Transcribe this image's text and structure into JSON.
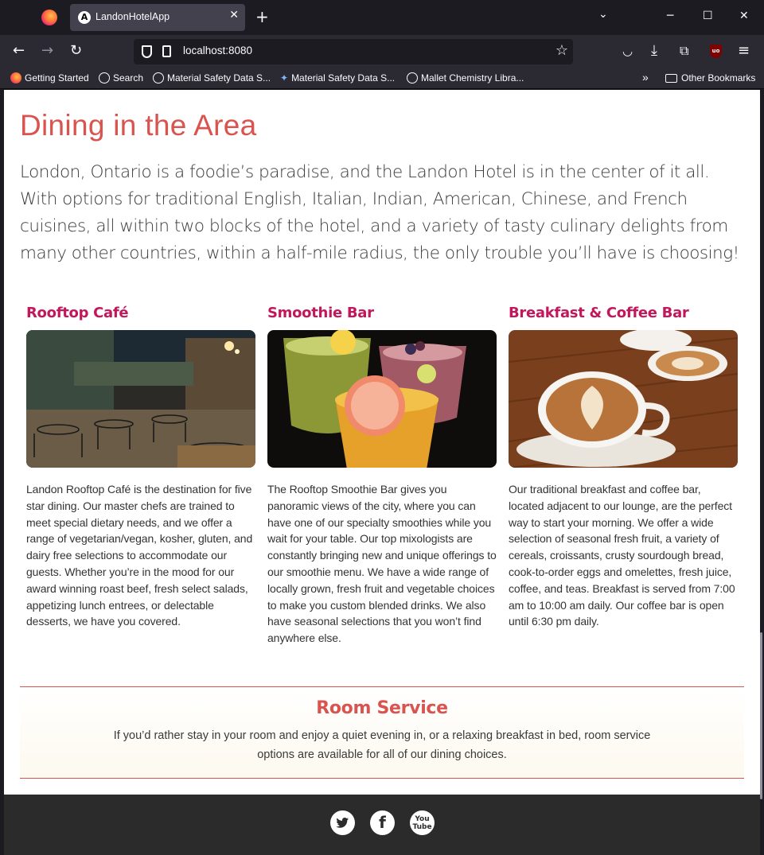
{
  "browser": {
    "tab_title": "LandonHotelApp",
    "tab_favicon_letter": "A",
    "url": "localhost:8080",
    "bookmarks": [
      {
        "label": "Getting Started",
        "icon": "firefox-icon"
      },
      {
        "label": "Search",
        "icon": "globe-icon"
      },
      {
        "label": "Material Safety Data S...",
        "icon": "globe-icon"
      },
      {
        "label": "Material Safety Data S...",
        "icon": "sparkle-icon"
      },
      {
        "label": "Mallet Chemistry Libra...",
        "icon": "globe-icon"
      }
    ],
    "other_bookmarks": "Other Bookmarks",
    "ublock_label": "uo"
  },
  "dining": {
    "title": "Dining in the Area",
    "intro": "London, Ontario is a foodie’s paradise, and the Landon Hotel is in the center of it all. With options for traditional English, Italian, Indian, American, Chinese, and French cuisines, all within two blocks of the hotel, and a variety of tasty culinary delights from many other countries, within a half-mile radius, the only trouble you’ll have is choosing!",
    "venues": [
      {
        "name": "Rooftop Café",
        "description": "Landon Rooftop Café is the destination for five star dining. Our master chefs are trained to meet special dietary needs, and we offer a range of vegetarian/vegan, kosher, gluten, and dairy free selections to accommodate our guests. Whether you’re in the mood for our award winning roast beef, fresh select salads, appetizing lunch entrees, or delectable desserts, we have you covered."
      },
      {
        "name": "Smoothie Bar",
        "description": "The Rooftop Smoothie Bar gives you panoramic views of the city, where you can have one of our specialty smoothies while you wait for your table. Our top mixologists are constantly bringing new and unique offerings to our smoothie menu. We have a wide range of locally grown, fresh fruit and vegetable choices to make you custom blended drinks. We also have seasonal selections that you won’t find anywhere else."
      },
      {
        "name": "Breakfast & Coffee Bar",
        "description": "Our traditional breakfast and coffee bar, located adjacent to our lounge, are the perfect way to start your morning. We offer a wide selection of seasonal fresh fruit, a variety of cereals, croissants, crusty sourdough bread, cook-to-order eggs and omelettes, fresh juice, coffee, and teas. Breakfast is served from 7:00 am to 10:00 am daily. Our coffee bar is open until 6:30 pm daily."
      }
    ]
  },
  "room_service": {
    "title": "Room Service",
    "text": "If you’d rather stay in your room and enjoy a quiet evening in, or a relaxing breakfast in bed, room service options are available for all of our dining choices."
  },
  "footer": {
    "social": [
      {
        "icon": "twitter-icon"
      },
      {
        "icon": "facebook-icon"
      },
      {
        "icon": "youtube-icon",
        "text": "You Tube"
      }
    ]
  },
  "colors": {
    "accent": "#d9544f",
    "venue_heading": "#c2185b",
    "footer_bg": "#2b2b2b"
  }
}
